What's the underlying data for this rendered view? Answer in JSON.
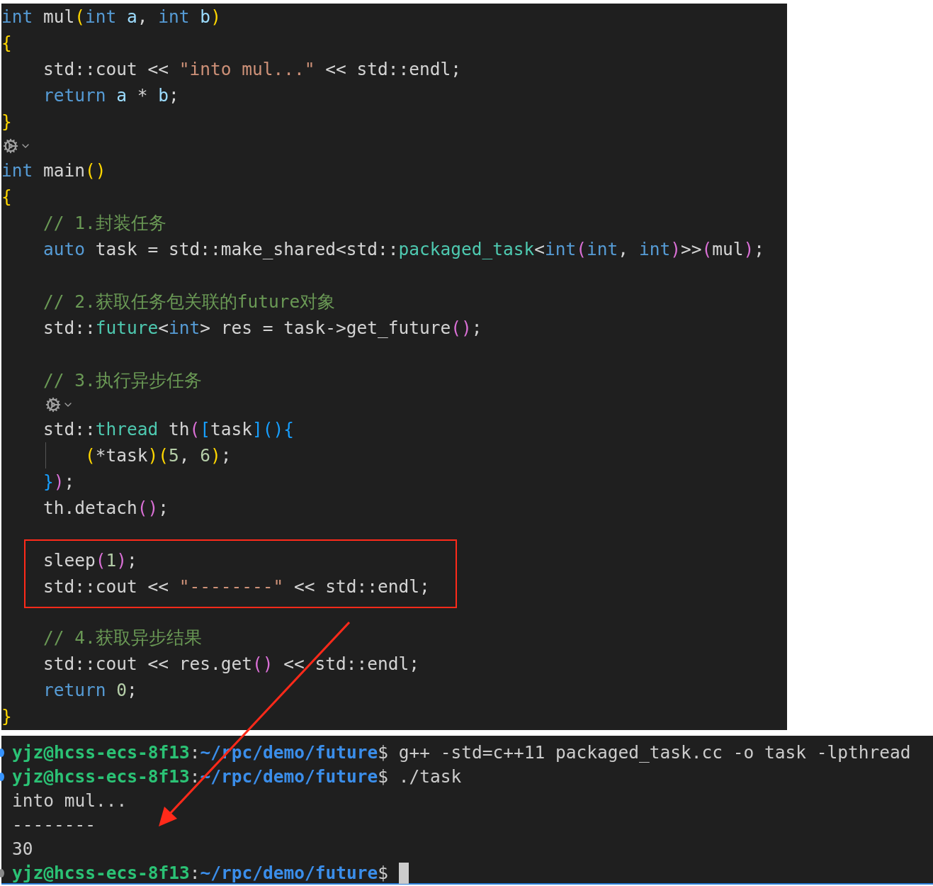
{
  "editor": {
    "lines": [
      {
        "kind": "code",
        "tokens": [
          {
            "kind": "kw",
            "text": "int"
          },
          {
            "kind": "plain",
            "text": " mul"
          },
          {
            "kind": "b1",
            "text": "("
          },
          {
            "kind": "kw",
            "text": "int"
          },
          {
            "kind": "param",
            "text": " a"
          },
          {
            "kind": "plain",
            "text": ", "
          },
          {
            "kind": "kw",
            "text": "int"
          },
          {
            "kind": "param",
            "text": " b"
          },
          {
            "kind": "b1",
            "text": ")"
          }
        ]
      },
      {
        "kind": "code",
        "tokens": [
          {
            "kind": "b1",
            "text": "{"
          }
        ]
      },
      {
        "kind": "code",
        "tokens": [
          {
            "kind": "plain",
            "text": "    std::cout << "
          },
          {
            "kind": "str",
            "text": "\"into mul...\""
          },
          {
            "kind": "plain",
            "text": " << std::endl;"
          }
        ]
      },
      {
        "kind": "code",
        "tokens": [
          {
            "kind": "kw",
            "text": "    return"
          },
          {
            "kind": "param",
            "text": " a"
          },
          {
            "kind": "plain",
            "text": " * "
          },
          {
            "kind": "param",
            "text": "b"
          },
          {
            "kind": "plain",
            "text": ";"
          }
        ]
      },
      {
        "kind": "code",
        "tokens": [
          {
            "kind": "b1",
            "text": "}"
          }
        ]
      },
      {
        "kind": "codelens"
      },
      {
        "kind": "code",
        "tokens": [
          {
            "kind": "kw",
            "text": "int"
          },
          {
            "kind": "plain",
            "text": " main"
          },
          {
            "kind": "b1",
            "text": "()"
          }
        ]
      },
      {
        "kind": "code",
        "tokens": [
          {
            "kind": "b1",
            "text": "{"
          }
        ]
      },
      {
        "kind": "code",
        "tokens": [
          {
            "kind": "comment",
            "text": "    // 1.封装任务"
          }
        ]
      },
      {
        "kind": "code",
        "tokens": [
          {
            "kind": "kw",
            "text": "    auto"
          },
          {
            "kind": "plain",
            "text": " task = std::make_shared<std::"
          },
          {
            "kind": "type",
            "text": "packaged_task"
          },
          {
            "kind": "plain",
            "text": "<"
          },
          {
            "kind": "kw",
            "text": "int"
          },
          {
            "kind": "b2",
            "text": "("
          },
          {
            "kind": "kw",
            "text": "int"
          },
          {
            "kind": "plain",
            "text": ", "
          },
          {
            "kind": "kw",
            "text": "int"
          },
          {
            "kind": "b2",
            "text": ")"
          },
          {
            "kind": "plain",
            "text": ">>"
          },
          {
            "kind": "b2",
            "text": "("
          },
          {
            "kind": "plain",
            "text": "mul"
          },
          {
            "kind": "b2",
            "text": ")"
          },
          {
            "kind": "plain",
            "text": ";"
          }
        ]
      },
      {
        "kind": "blank"
      },
      {
        "kind": "code",
        "tokens": [
          {
            "kind": "comment",
            "text": "    // 2.获取任务包关联的future对象"
          }
        ]
      },
      {
        "kind": "code",
        "tokens": [
          {
            "kind": "plain",
            "text": "    std::"
          },
          {
            "kind": "type",
            "text": "future"
          },
          {
            "kind": "plain",
            "text": "<"
          },
          {
            "kind": "kw",
            "text": "int"
          },
          {
            "kind": "plain",
            "text": "> res = task->get_future"
          },
          {
            "kind": "b2",
            "text": "()"
          },
          {
            "kind": "plain",
            "text": ";"
          }
        ]
      },
      {
        "kind": "blank"
      },
      {
        "kind": "code",
        "tokens": [
          {
            "kind": "comment",
            "text": "    // 3.执行异步任务"
          }
        ]
      },
      {
        "kind": "codelens"
      },
      {
        "kind": "code",
        "tokens": [
          {
            "kind": "plain",
            "text": "    std::"
          },
          {
            "kind": "type",
            "text": "thread"
          },
          {
            "kind": "plain",
            "text": " th"
          },
          {
            "kind": "b2",
            "text": "("
          },
          {
            "kind": "b3",
            "text": "["
          },
          {
            "kind": "plain",
            "text": "task"
          },
          {
            "kind": "b3",
            "text": "]"
          },
          {
            "kind": "b3",
            "text": "(){"
          }
        ]
      },
      {
        "kind": "code",
        "guide": true,
        "tokens": [
          {
            "kind": "b1",
            "text": "        ("
          },
          {
            "kind": "plain",
            "text": "*task"
          },
          {
            "kind": "b1",
            "text": ")("
          },
          {
            "kind": "num",
            "text": "5"
          },
          {
            "kind": "plain",
            "text": ", "
          },
          {
            "kind": "num",
            "text": "6"
          },
          {
            "kind": "b1",
            "text": ")"
          },
          {
            "kind": "plain",
            "text": ";"
          }
        ]
      },
      {
        "kind": "code",
        "tokens": [
          {
            "kind": "b3",
            "text": "    }"
          },
          {
            "kind": "b2",
            "text": ")"
          },
          {
            "kind": "plain",
            "text": ";"
          }
        ]
      },
      {
        "kind": "code",
        "tokens": [
          {
            "kind": "plain",
            "text": "    th.detach"
          },
          {
            "kind": "b2",
            "text": "()"
          },
          {
            "kind": "plain",
            "text": ";"
          }
        ]
      },
      {
        "kind": "blank"
      },
      {
        "kind": "boxed_group",
        "lines": [
          {
            "kind": "code",
            "tokens": [
              {
                "kind": "plain",
                "text": "    sleep"
              },
              {
                "kind": "b2",
                "text": "("
              },
              {
                "kind": "num",
                "text": "1"
              },
              {
                "kind": "b2",
                "text": ")"
              },
              {
                "kind": "plain",
                "text": ";"
              }
            ]
          },
          {
            "kind": "code",
            "tokens": [
              {
                "kind": "plain",
                "text": "    std::cout << "
              },
              {
                "kind": "str",
                "text": "\"--------\""
              },
              {
                "kind": "plain",
                "text": " << std::endl;"
              }
            ]
          }
        ]
      },
      {
        "kind": "blank"
      },
      {
        "kind": "code",
        "tokens": [
          {
            "kind": "comment",
            "text": "    // 4.获取异步结果"
          }
        ]
      },
      {
        "kind": "code",
        "tokens": [
          {
            "kind": "plain",
            "text": "    std::cout << res.get"
          },
          {
            "kind": "b2",
            "text": "()"
          },
          {
            "kind": "plain",
            "text": " << std::endl;"
          }
        ]
      },
      {
        "kind": "code",
        "tokens": [
          {
            "kind": "kw",
            "text": "    return"
          },
          {
            "kind": "num",
            "text": " 0"
          },
          {
            "kind": "plain",
            "text": ";"
          }
        ]
      },
      {
        "kind": "code",
        "tokens": [
          {
            "kind": "b1",
            "text": "}"
          }
        ]
      }
    ]
  },
  "terminal": {
    "lines": [
      {
        "kind": "prompt",
        "user": "yjz@hcss-ecs-8f13",
        "separator": ":",
        "path": "~/rpc/demo/future",
        "symbol": "$",
        "command": "g++ -std=c++11 packaged_task.cc -o task -lpthread",
        "color": "#3794ff",
        "cursor": false
      },
      {
        "kind": "prompt",
        "user": "yjz@hcss-ecs-8f13",
        "separator": ":",
        "path": "~/rpc/demo/future",
        "symbol": "$",
        "command": "./task",
        "color": "#3794ff",
        "cursor": false
      },
      {
        "kind": "output",
        "text": "into mul..."
      },
      {
        "kind": "output",
        "text": "--------"
      },
      {
        "kind": "output",
        "text": "30"
      },
      {
        "kind": "prompt",
        "user": "yjz@hcss-ecs-8f13",
        "separator": ":",
        "path": "~/rpc/demo/future",
        "symbol": "$",
        "color": "#8a8a8a",
        "cursor": true
      }
    ]
  }
}
